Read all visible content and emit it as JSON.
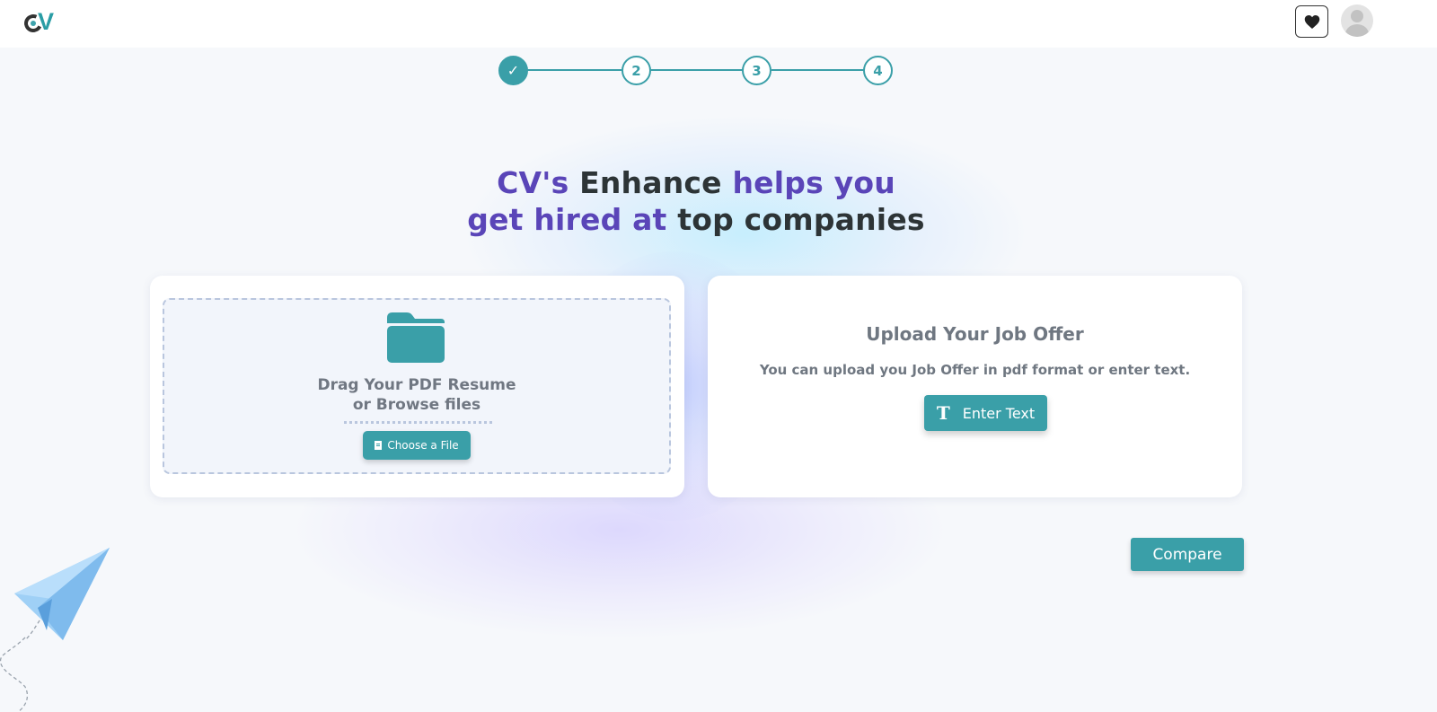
{
  "header": {
    "logo_icon": "cv-logo",
    "favorites_icon": "heart-icon",
    "avatar_icon": "user-avatar"
  },
  "stepper": {
    "steps": [
      {
        "label": "✓",
        "state": "done"
      },
      {
        "label": "2",
        "state": "pending"
      },
      {
        "label": "3",
        "state": "pending"
      },
      {
        "label": "4",
        "state": "pending"
      }
    ]
  },
  "hero": {
    "part1": "CV's",
    "part2": "Enhance",
    "part3": "helps you",
    "part4": "get hired at",
    "part5": "top companies"
  },
  "resume_upload": {
    "line1": "Drag Your PDF Resume",
    "line2": "or Browse files",
    "button_label": "Choose a File"
  },
  "job_offer": {
    "title": "Upload Your Job Offer",
    "description": "You can upload you Job Offer in pdf format or enter text.",
    "button_label": "Enter Text",
    "button_icon": "T"
  },
  "compare_label": "Compare",
  "colors": {
    "accent": "#3a9fa8",
    "headline_purple": "#5a45b8",
    "headline_dark": "#2d3436",
    "background": "#f6f8fb"
  }
}
